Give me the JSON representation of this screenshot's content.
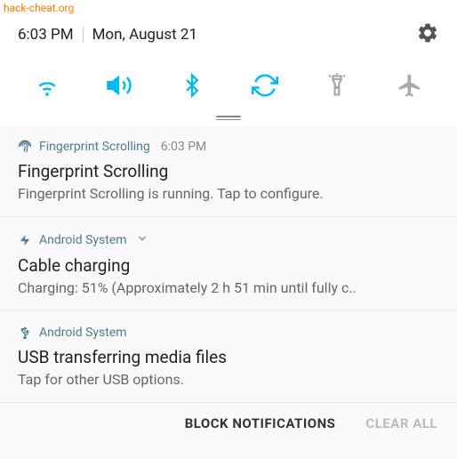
{
  "watermark": "hack-cheat.org",
  "status": {
    "time": "6:03 PM",
    "date": "Mon, August 21"
  },
  "quick_settings": {
    "wifi": "wifi-icon",
    "sound": "volume-icon",
    "bluetooth": "bluetooth-icon",
    "rotate": "rotate-icon",
    "flashlight": "flashlight-icon",
    "airplane": "airplane-icon"
  },
  "notifications": [
    {
      "icon_color": "#4d7a8f",
      "app": "Fingerprint Scrolling",
      "time": "6:03 PM",
      "title": "Fingerprint Scrolling",
      "body": "Fingerprint Scrolling is running. Tap to configure.",
      "expandable": false
    },
    {
      "icon_color": "#4d7a8f",
      "app": "Android System",
      "time": "",
      "title": "Cable charging",
      "body": "Charging: 51% (Approximately 2 h 51 min until fully c..",
      "expandable": true
    },
    {
      "icon_color": "#4d7a8f",
      "app": "Android System",
      "time": "",
      "title": "USB transferring media files",
      "body": "Tap for other USB options.",
      "expandable": false
    }
  ],
  "actions": {
    "block": "BLOCK NOTIFICATIONS",
    "clear": "CLEAR ALL"
  }
}
